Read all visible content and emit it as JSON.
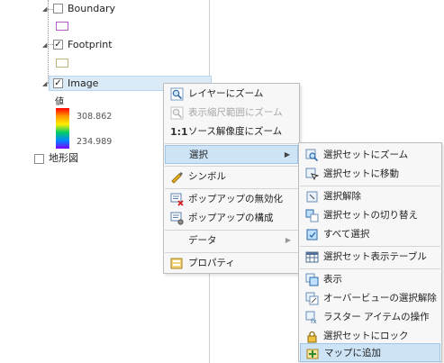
{
  "toc": {
    "layers": [
      {
        "label": "Boundary",
        "checked": false,
        "swatch": {
          "fill": "#ffffff",
          "stroke": "#b05cc0"
        }
      },
      {
        "label": "Footprint",
        "checked": true,
        "swatch": {
          "fill": "#ffffff",
          "stroke": "#b9b37a"
        }
      },
      {
        "label": "Image",
        "checked": true
      }
    ],
    "legend": {
      "title": "値",
      "max": "308.862",
      "min": "234.989",
      "ramp_colors": [
        "#ff0000",
        "#ff9900",
        "#ffee00",
        "#00cc66",
        "#0088ff",
        "#7b00ff"
      ]
    },
    "basemap": {
      "label": "地形図",
      "checked": false
    }
  },
  "context_menu": {
    "items": [
      {
        "label": "レイヤーにズーム",
        "icon": "zoom-to-layer-icon",
        "disabled": false
      },
      {
        "label": "表示縮尺範囲にズーム",
        "icon": "zoom-visible-scale-icon",
        "disabled": true
      },
      {
        "label": "ソース解像度にズーム",
        "icon": "source-resolution-icon",
        "icon_text": "1:1",
        "disabled": false
      },
      {
        "label": "選択",
        "icon": "",
        "disabled": false,
        "submenu": true,
        "highlighted": true
      },
      {
        "label": "シンボル",
        "icon": "symbology-icon",
        "disabled": false
      },
      {
        "label": "ポップアップの無効化",
        "icon": "disable-popups-icon",
        "disabled": false
      },
      {
        "label": "ポップアップの構成",
        "icon": "configure-popups-icon",
        "disabled": false
      },
      {
        "label": "データ",
        "icon": "",
        "disabled": false,
        "submenu": true
      },
      {
        "label": "プロパティ",
        "icon": "properties-icon",
        "disabled": false
      }
    ]
  },
  "submenu": {
    "items": [
      {
        "label": "選択セットにズーム",
        "icon": "zoom-to-selection-icon"
      },
      {
        "label": "選択セットに移動",
        "icon": "pan-to-selection-icon"
      },
      {
        "label": "選択解除",
        "icon": "clear-selection-icon"
      },
      {
        "label": "選択セットの切り替え",
        "icon": "switch-selection-icon"
      },
      {
        "label": "すべて選択",
        "icon": "select-all-icon"
      },
      {
        "label": "選択セット表示テーブル",
        "icon": "selection-table-icon"
      },
      {
        "label": "表示",
        "icon": "show-icon"
      },
      {
        "label": "オーバービューの選択解除",
        "icon": "overview-clear-icon"
      },
      {
        "label": "ラスター アイテムの操作",
        "icon": "raster-item-icon"
      },
      {
        "label": "選択セットにロック",
        "icon": "lock-selection-icon"
      },
      {
        "label": "マップに追加",
        "icon": "add-to-map-icon",
        "highlighted": true
      }
    ]
  }
}
